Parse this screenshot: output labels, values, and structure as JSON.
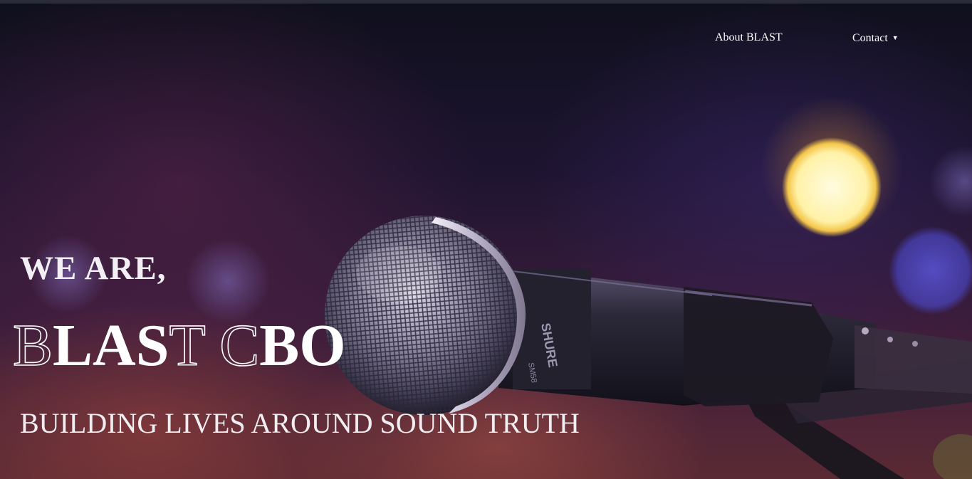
{
  "nav": {
    "about_label": "About BLAST",
    "contact_label": "Contact",
    "contact_caret": "▼"
  },
  "hero": {
    "eyebrow": "WE ARE,",
    "brand_parts": [
      {
        "text": "B",
        "style": "outline"
      },
      {
        "text": "LAS",
        "style": "solid"
      },
      {
        "text": "T C",
        "style": "outline"
      },
      {
        "text": "BO",
        "style": "solid"
      }
    ],
    "tagline": "BUILDING LIVES AROUND SOUND TRUTH",
    "mic_brand": "SHURE",
    "mic_model": "SM58"
  },
  "colors": {
    "top_strip": "#2b2c3a",
    "text": "#ffffff",
    "bokeh_yellow": "#fff1b0"
  }
}
